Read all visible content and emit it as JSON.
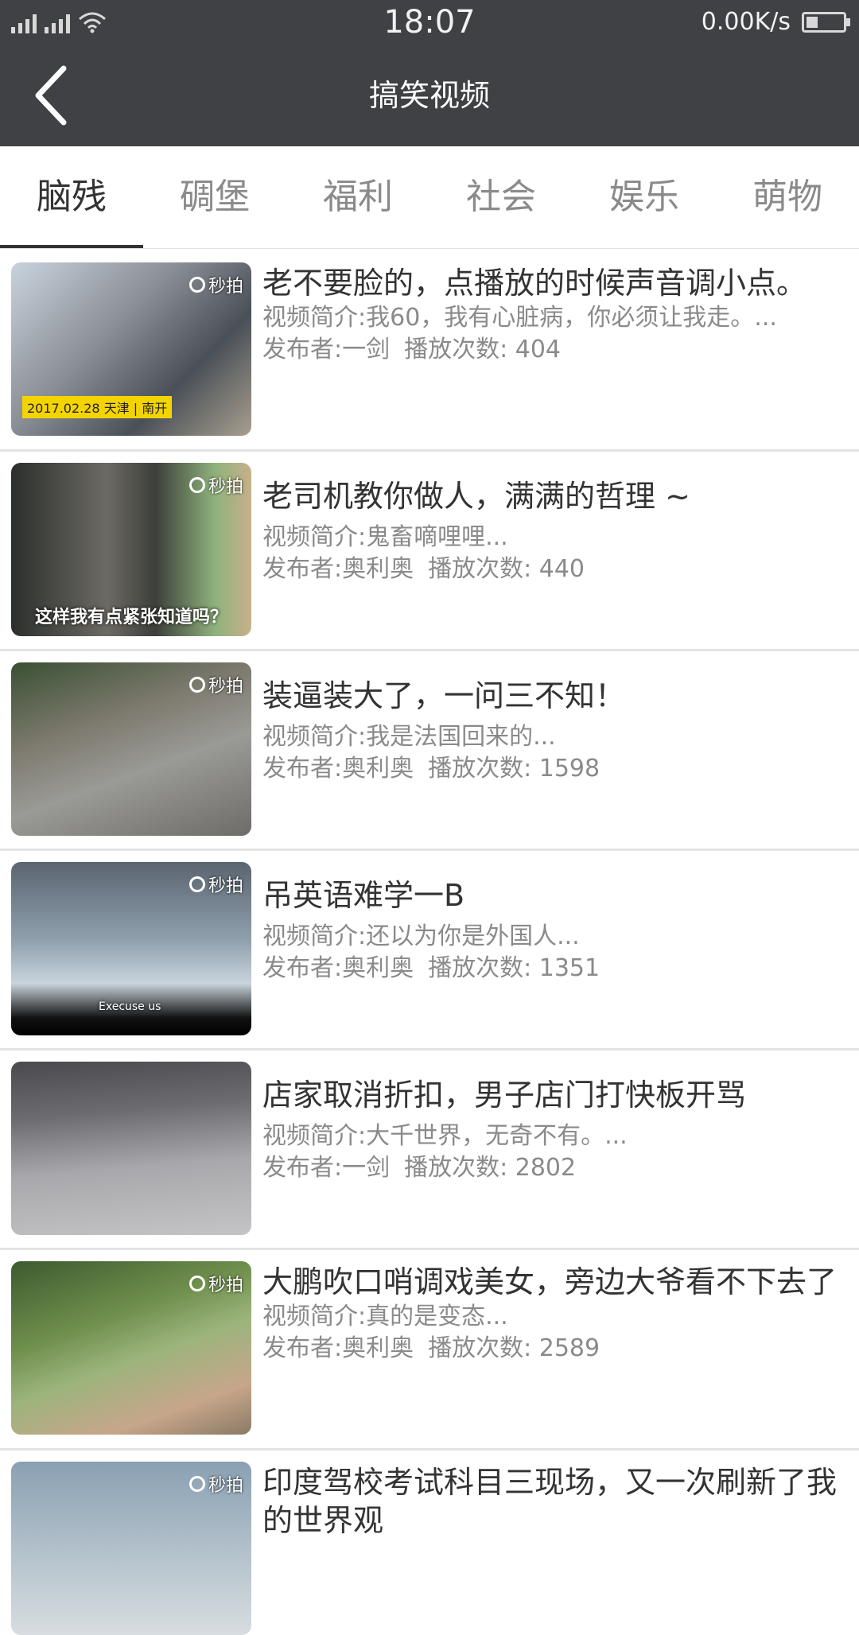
{
  "status_bar": {
    "time": "18:07",
    "net_speed": "0.00K/s",
    "icons": [
      "signal-icon",
      "signal-icon",
      "wifi-icon",
      "battery-icon"
    ]
  },
  "header": {
    "title": "搞笑视频",
    "back_icon": "back-arrow-icon"
  },
  "tabs": [
    {
      "label": "脑残",
      "active": true
    },
    {
      "label": "碉堡",
      "active": false
    },
    {
      "label": "福利",
      "active": false
    },
    {
      "label": "社会",
      "active": false
    },
    {
      "label": "娱乐",
      "active": false
    },
    {
      "label": "萌物",
      "active": false
    }
  ],
  "videos": [
    {
      "title": "老不要脸的，点播放的时候声音调小点。",
      "desc": "视频简介:我60，我有心脏病，你必须让我走。...",
      "publisher": "发布者:一剑",
      "plays": "播放次数: 404",
      "thumb_logo": "秒拍",
      "thumb_caption": "2017.02.28  天津 | 南开",
      "thumb_subtitle": ""
    },
    {
      "title": "老司机教你做人，满满的哲理 ~",
      "desc": "视频简介:鬼畜嘀哩哩...",
      "publisher": "发布者:奥利奥",
      "plays": "播放次数: 440",
      "thumb_logo": "秒拍",
      "thumb_caption": "",
      "thumb_subtitle": "这样我有点紧张知道吗？"
    },
    {
      "title": "装逼装大了，一问三不知！",
      "desc": "视频简介:我是法国回来的...",
      "publisher": "发布者:奥利奥",
      "plays": "播放次数: 1598",
      "thumb_logo": "秒拍",
      "thumb_caption": "",
      "thumb_subtitle": ""
    },
    {
      "title": "吊英语难学一B",
      "desc": "视频简介:还以为你是外国人...",
      "publisher": "发布者:奥利奥",
      "plays": "播放次数: 1351",
      "thumb_logo": "秒拍",
      "thumb_caption": "",
      "thumb_subtitle": "Execuse us"
    },
    {
      "title": "店家取消折扣，男子店门打快板开骂",
      "desc": "视频简介:大千世界，无奇不有。...",
      "publisher": "发布者:一剑",
      "plays": "播放次数: 2802",
      "thumb_logo": "",
      "thumb_caption": "",
      "thumb_subtitle": ""
    },
    {
      "title": "大鹏吹口哨调戏美女，旁边大爷看不下去了",
      "desc": "视频简介:真的是变态...",
      "publisher": "发布者:奥利奥",
      "plays": "播放次数: 2589",
      "thumb_logo": "秒拍",
      "thumb_caption": "",
      "thumb_subtitle": ""
    },
    {
      "title": "印度驾校考试科目三现场，又一次刷新了我的世界观",
      "desc": "",
      "publisher": "",
      "plays": "",
      "thumb_logo": "秒拍",
      "thumb_caption": "",
      "thumb_subtitle": ""
    }
  ],
  "colors": {
    "header_bg": "#3f4144",
    "tab_active": "#333333",
    "tab_inactive": "#8a8a8a",
    "divider": "#e4e4e4"
  }
}
